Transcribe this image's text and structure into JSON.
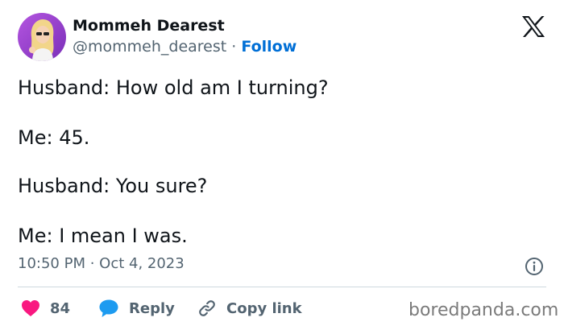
{
  "author": {
    "display_name": "Mommeh Dearest",
    "handle": "@mommeh_dearest",
    "separator": "·",
    "follow_label": "Follow"
  },
  "tweet": {
    "lines": [
      "Husband: How old am I turning?",
      "Me: 45.",
      "Husband: You sure?",
      "Me: I mean I was."
    ],
    "timestamp": "10:50 PM · Oct 4, 2023"
  },
  "actions": {
    "like_count": "84",
    "reply_label": "Reply",
    "copy_link_label": "Copy link"
  },
  "watermark": "boredpanda.com",
  "colors": {
    "like": "#f91880",
    "reply": "#1d9bf0",
    "follow": "#006fd6",
    "secondary_text": "#536471",
    "divider": "#cfd9de"
  },
  "icons": {
    "brand": "x-logo-icon",
    "like": "heart-icon",
    "reply": "speech-bubble-icon",
    "copy_link": "link-icon",
    "info": "info-icon"
  }
}
